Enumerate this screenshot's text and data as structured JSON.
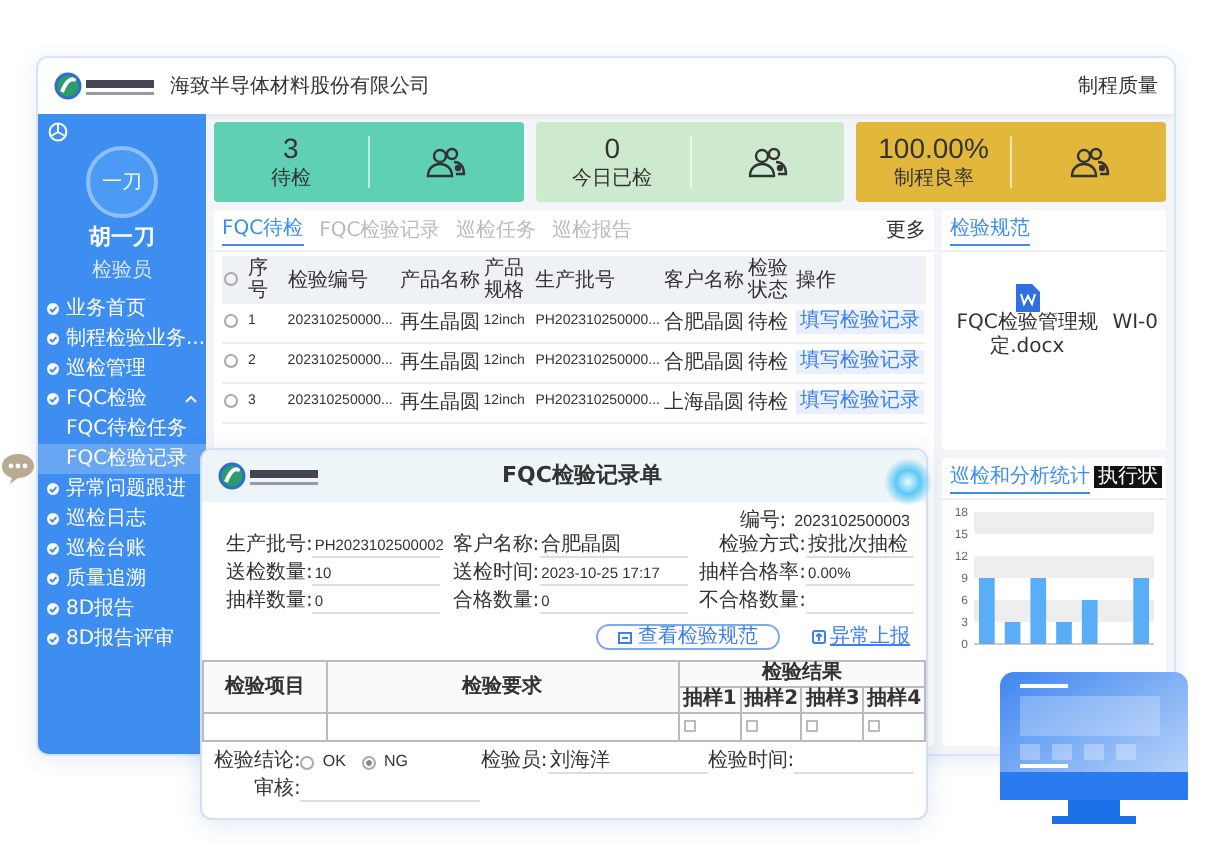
{
  "header": {
    "company": "海致半导体材料股份有限公司",
    "menu": [
      "制程质量"
    ]
  },
  "sidebar": {
    "user": {
      "avatar": "一刀",
      "name": "胡一刀",
      "role": "检验员"
    },
    "items": [
      {
        "label": "业务首页",
        "selected": false
      },
      {
        "label": "制程检验业务...",
        "selected": false
      },
      {
        "label": "巡检管理",
        "selected": false
      },
      {
        "label": "FQC检验",
        "selected": false,
        "expanded": true,
        "children": [
          {
            "label": "FQC待检任务",
            "selected": false
          },
          {
            "label": "FQC检验记录",
            "selected": true
          }
        ]
      },
      {
        "label": "异常问题跟进",
        "selected": false
      },
      {
        "label": "巡检日志",
        "selected": false
      },
      {
        "label": "巡检台账",
        "selected": false
      },
      {
        "label": "质量追溯",
        "selected": false
      },
      {
        "label": "8D报告",
        "selected": false
      },
      {
        "label": "8D报告评审",
        "selected": false
      }
    ]
  },
  "stats": [
    {
      "value": "3",
      "label": "待检",
      "color": "#5fd0b4"
    },
    {
      "value": "0",
      "label": "今日已检",
      "color": "#cdeacf"
    },
    {
      "value": "100.00%",
      "label": "制程良率",
      "color": "#e1b83c"
    }
  ],
  "tasks": {
    "tabs": [
      {
        "label": "FQC待检",
        "selected": true
      },
      {
        "label": "FQC检验记录",
        "selected": false
      },
      {
        "label": "巡检任务",
        "selected": false
      },
      {
        "label": "巡检报告",
        "selected": false
      }
    ],
    "more": "更多",
    "all_checked": false,
    "columns": [
      "序号",
      "检验编号",
      "产品名称",
      "产品规格",
      "生产批号",
      "客户名称",
      "检验状态",
      "操作"
    ],
    "rows": [
      {
        "checked": false,
        "cells": [
          "1",
          "202310250000...",
          "再生晶圆",
          "12inch",
          "PH202310250000...",
          "合肥晶圆",
          "待检"
        ],
        "action": "填写检验记录"
      },
      {
        "checked": false,
        "cells": [
          "2",
          "202310250000...",
          "再生晶圆",
          "12inch",
          "PH202310250000...",
          "合肥晶圆",
          "待检"
        ],
        "action": "填写检验记录"
      },
      {
        "checked": false,
        "cells": [
          "3",
          "202310250000...",
          "再生晶圆",
          "12inch",
          "PH202310250000...",
          "上海晶圆",
          "待检"
        ],
        "action": "填写检验记录"
      }
    ]
  },
  "standards": {
    "tab": "检验规范",
    "files": [
      {
        "name": "FQC检验管理规定.docx",
        "kind": "word"
      },
      {
        "name": "WI-0",
        "kind": "plain"
      }
    ]
  },
  "analysis": {
    "title": "巡检和分析统计",
    "tooltip": "执行状",
    "chart_data": {
      "type": "bar",
      "values": [
        9,
        3,
        9,
        3,
        6,
        null,
        9
      ],
      "ylim": [
        0,
        18
      ],
      "yticks": [
        0,
        3,
        6,
        9,
        12,
        15,
        18
      ]
    }
  },
  "form": {
    "title": "FQC检验记录单",
    "number_label": "编号:",
    "number": "2023102500003",
    "fields": [
      {
        "label": "生产批号:",
        "value": "PH2023102500002"
      },
      {
        "label": "客户名称:",
        "value": "合肥晶圆"
      },
      {
        "label": "检验方式:",
        "value": "按批次抽检"
      },
      {
        "label": "送检数量:",
        "value": "10"
      },
      {
        "label": "送检时间:",
        "value": "2023-10-25 17:17"
      },
      {
        "label": "抽样合格率:",
        "value": "0.00%"
      },
      {
        "label": "抽样数量:",
        "value": "0"
      },
      {
        "label": "合格数量:",
        "value": "0"
      },
      {
        "label": "不合格数量:"
      }
    ],
    "view_button": "查看检验规范",
    "report_link": "异常上报",
    "table": {
      "columns": [
        "检验项目",
        "检验要求"
      ],
      "result_header": "检验结果",
      "samples": [
        "抽样1",
        "抽样2",
        "抽样3",
        "抽样4"
      ],
      "checks": [
        false,
        false,
        false,
        false
      ]
    },
    "conclusion": {
      "label": "检验结论:",
      "options": [
        {
          "label": "OK",
          "selected": false
        },
        {
          "label": "NG",
          "selected": true
        }
      ]
    },
    "inspector": {
      "label": "检验员:",
      "value": "刘海洋"
    },
    "time": {
      "label": "检验时间:"
    },
    "review": {
      "label": "审核:"
    }
  }
}
